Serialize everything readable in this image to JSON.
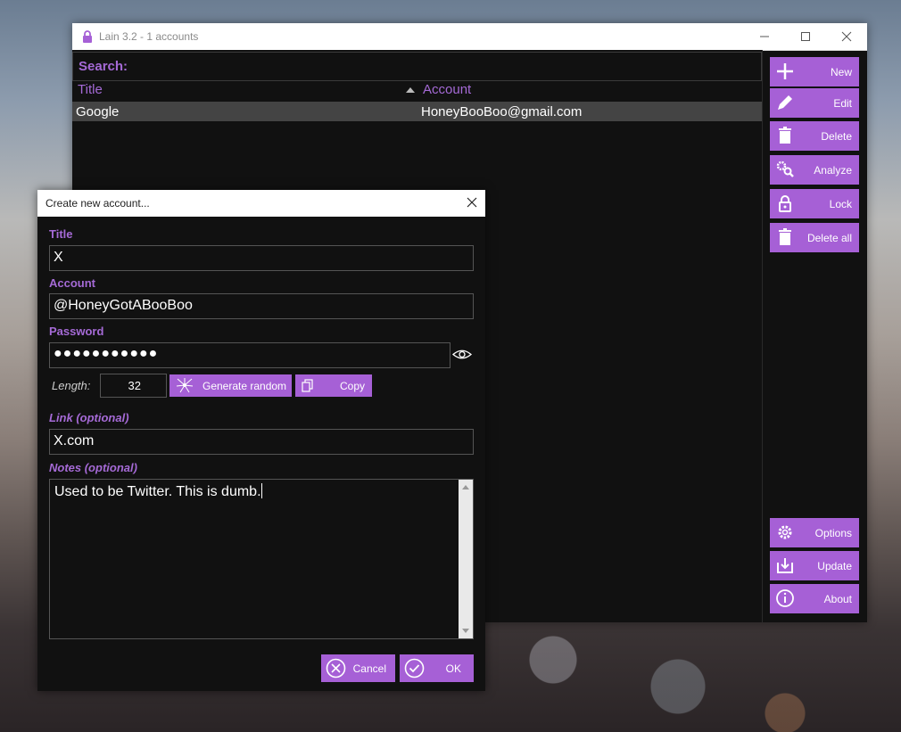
{
  "window": {
    "title": "Lain 3.2 - 1 accounts"
  },
  "search": {
    "label": "Search:"
  },
  "table": {
    "columns": [
      "Title",
      "Account"
    ],
    "rows": [
      {
        "title": "Google",
        "account": "HoneyBooBoo@gmail.com"
      }
    ]
  },
  "sidebar": {
    "top": [
      {
        "label": "New",
        "icon": "plus-icon"
      },
      {
        "label": "Edit",
        "icon": "pencil-icon"
      },
      {
        "label": "Delete",
        "icon": "trash-icon"
      },
      {
        "label": "Analyze",
        "icon": "gears-search-icon"
      },
      {
        "label": "Lock",
        "icon": "lock-icon"
      },
      {
        "label": "Delete all",
        "icon": "trash-icon"
      }
    ],
    "bottom": [
      {
        "label": "Options",
        "icon": "gear-icon"
      },
      {
        "label": "Update",
        "icon": "download-icon"
      },
      {
        "label": "About",
        "icon": "info-icon"
      }
    ]
  },
  "dialog": {
    "title": "Create new account...",
    "fields": {
      "title_label": "Title",
      "title_value": "X",
      "account_label": "Account",
      "account_value": "@HoneyGotABooBoo",
      "password_label": "Password",
      "password_value": "●●●●●●●●●●●",
      "length_label": "Length:",
      "length_value": "32",
      "generate_label": "Generate random",
      "copy_label": "Copy",
      "link_label": "Link (optional)",
      "link_value": "X.com",
      "notes_label": "Notes (optional)",
      "notes_value": "Used to be Twitter. This is dumb."
    },
    "buttons": {
      "cancel": "Cancel",
      "ok": "OK"
    }
  },
  "colors": {
    "accent": "#a660d6",
    "label": "#a56ad6",
    "background": "#111111",
    "selected_row": "#444444"
  }
}
